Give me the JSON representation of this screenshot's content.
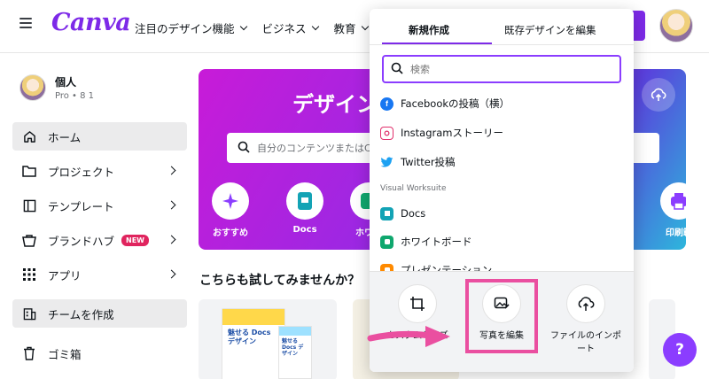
{
  "header": {
    "logo": "Canva",
    "nav": [
      "注目のデザイン機能",
      "ビジネス",
      "教育"
    ]
  },
  "sidebar": {
    "profile": {
      "name": "個人",
      "plan": "Pro • ⁠8 1"
    },
    "items": [
      {
        "label": "ホーム",
        "icon": "home-icon",
        "active": true
      },
      {
        "label": "プロジェクト",
        "icon": "folder-icon"
      },
      {
        "label": "テンプレート",
        "icon": "template-icon"
      },
      {
        "label": "ブランドハブ",
        "icon": "brand-icon",
        "badge": "NEW"
      },
      {
        "label": "アプリ",
        "icon": "apps-icon"
      },
      {
        "label": "チームを作成",
        "icon": "team-icon"
      },
      {
        "label": "ゴミ箱",
        "icon": "trash-icon"
      }
    ]
  },
  "hero": {
    "title": "デザイン",
    "search_placeholder": "自分のコンテンツまたはC",
    "categories": [
      "おすすめ",
      "Docs",
      "ホワイ",
      "印刷範"
    ]
  },
  "main": {
    "section_title": "こちらも試してみませんか？",
    "card_docs": {
      "title_a": "魅せる Docs デザイン",
      "title_b": "魅せる Docs デザイン"
    }
  },
  "dropdown": {
    "tabs": [
      "新規作成",
      "既存デザインを編集"
    ],
    "search_placeholder": "検索",
    "items": [
      {
        "label": "Facebookの投稿（横）",
        "icon": "facebook-icon"
      },
      {
        "label": "Instagramストーリー",
        "icon": "instagram-icon"
      },
      {
        "label": "Twitter投稿",
        "icon": "twitter-icon"
      }
    ],
    "group_label": "Visual Worksuite",
    "worksuite": [
      {
        "label": "Docs",
        "icon": "docs-icon"
      },
      {
        "label": "ホワイトボード",
        "icon": "whiteboard-icon"
      },
      {
        "label": "プレゼンテーション",
        "icon": "presentation-icon"
      }
    ],
    "bottom": [
      {
        "label": "カスタムサイズ",
        "icon": "custom-size-icon"
      },
      {
        "label": "写真を編集",
        "icon": "edit-photo-icon"
      },
      {
        "label": "ファイルのインポート",
        "icon": "import-file-icon"
      }
    ]
  },
  "help": "?",
  "colors": {
    "accent": "#7d2ae8",
    "highlight": "#ea4fa0",
    "new_badge": "#e0245e"
  }
}
